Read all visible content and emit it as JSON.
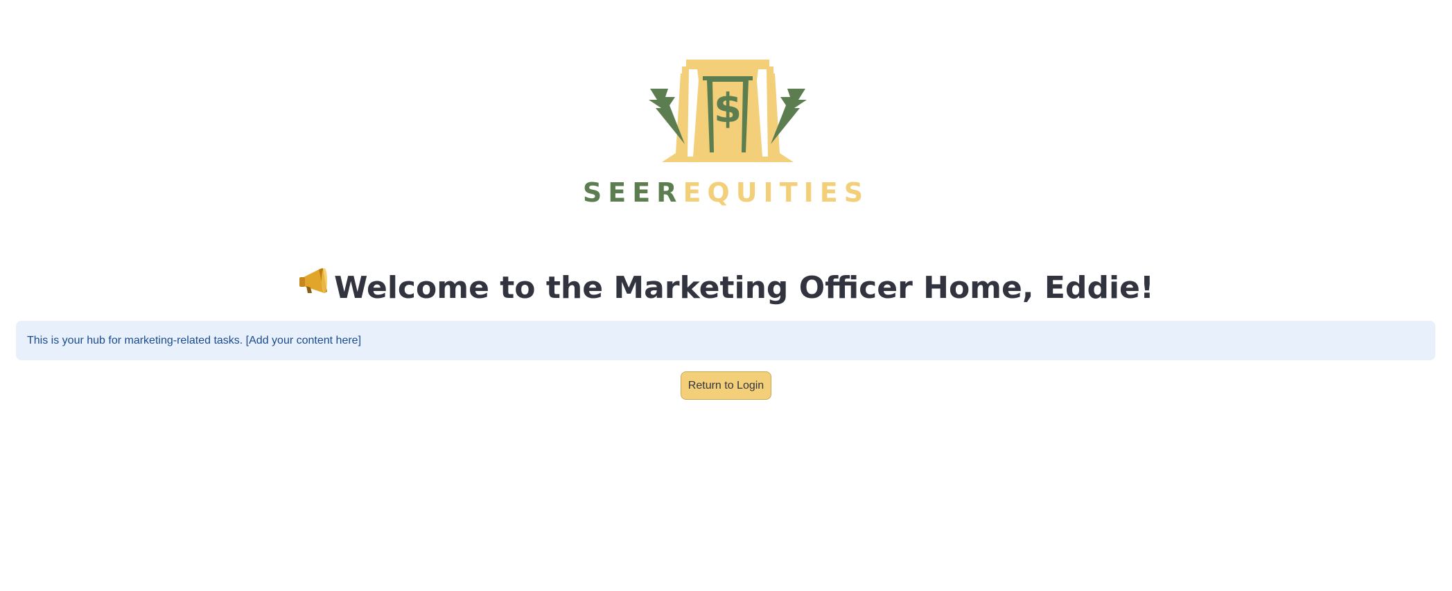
{
  "logo": {
    "word_part1": "SEER",
    "word_part2": "EQUITIES",
    "primary_color": "#5b7d4f",
    "accent_color": "#f2cf78"
  },
  "header": {
    "icon": "megaphone-icon",
    "title": "Welcome to the Marketing Officer Home, Eddie!"
  },
  "info": {
    "text": "This is your hub for marketing-related tasks. [Add your content here]"
  },
  "actions": {
    "return_label": "Return to Login"
  },
  "colors": {
    "title_text": "#31333f",
    "info_bg": "#e8f0fb",
    "info_text": "#194a8c",
    "button_bg": "#f2cf78"
  }
}
